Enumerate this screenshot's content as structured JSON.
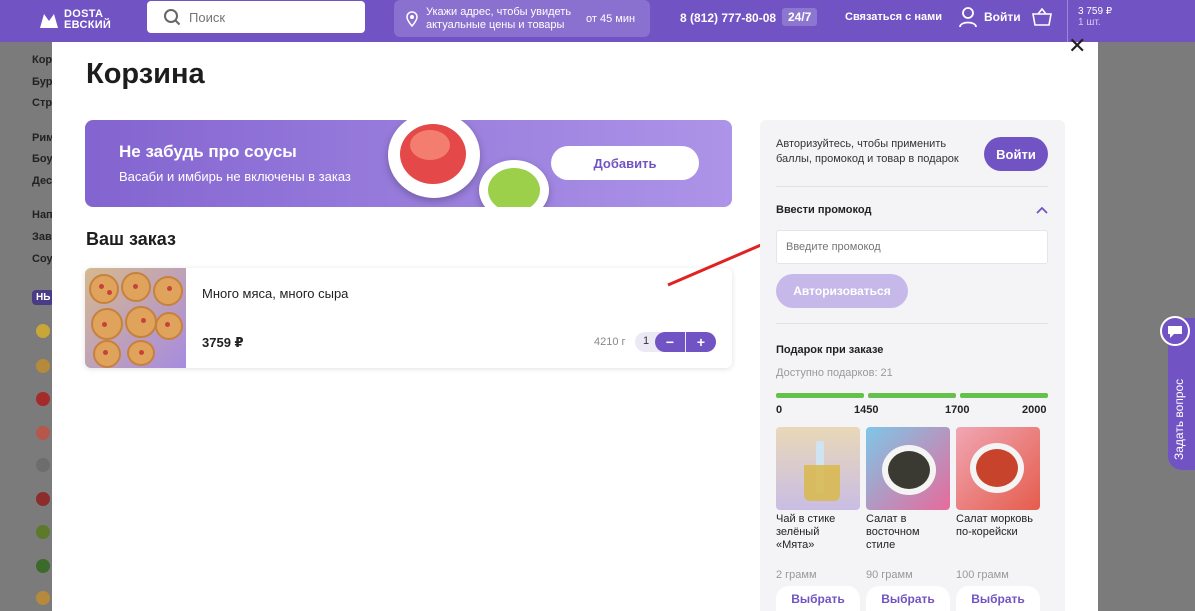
{
  "header": {
    "logo": "DOSTA\nЕВСКИЙ",
    "search_placeholder": "Поиск",
    "address_prompt": "Укажи адрес, чтобы увидеть актуальные цены и товары",
    "delivery_time": "от 45 мин",
    "phone": "8 (812) 777-80-08",
    "hours_badge": "24/7",
    "contact_label": "Связаться с нами",
    "login_label": "Войти",
    "cart_total": "3 759 ₽",
    "cart_count": "1 шт."
  },
  "left_nav": {
    "items": [
      "Кор",
      "Бур",
      "Стр",
      "Рим",
      "Боу",
      "Дес",
      "Нап",
      "Зав",
      "Соу"
    ],
    "badge": "НЬ"
  },
  "cart": {
    "title": "Корзина",
    "banner": {
      "title": "Не забудь про соусы",
      "subtitle": "Васаби и имбирь не включены в заказ",
      "button": "Добавить"
    },
    "order_heading": "Ваш заказ",
    "items": [
      {
        "name": "Много мяса, много сыра",
        "price": "3759 ₽",
        "weight": "4210 г",
        "quantity": "1"
      }
    ]
  },
  "sidebar": {
    "auth_text": "Авторизуйтесь, чтобы применить баллы, промокод и товар в подарок",
    "login_button": "Войти",
    "promo": {
      "heading": "Ввести промокод",
      "placeholder": "Введите промокод",
      "button": "Авторизоваться"
    },
    "gifts": {
      "heading": "Подарок при заказе",
      "available": "Доступно подарков: 21",
      "thresholds": [
        "0",
        "1450",
        "1700",
        "2000"
      ],
      "items": [
        {
          "name": "Чай в стике зелёный «Мята»",
          "weight": "2 грамм",
          "button": "Выбрать"
        },
        {
          "name": "Салат в восточном стиле",
          "weight": "90 грамм",
          "button": "Выбрать"
        },
        {
          "name": "Салат морковь по-корейски",
          "weight": "100 грамм",
          "button": "Выбрать"
        }
      ]
    }
  },
  "widget": {
    "ask_label": "Задать вопрос"
  },
  "colors": {
    "brand": "#7153c3",
    "progress": "#66c04c",
    "overlay": "#7b7b7b"
  }
}
